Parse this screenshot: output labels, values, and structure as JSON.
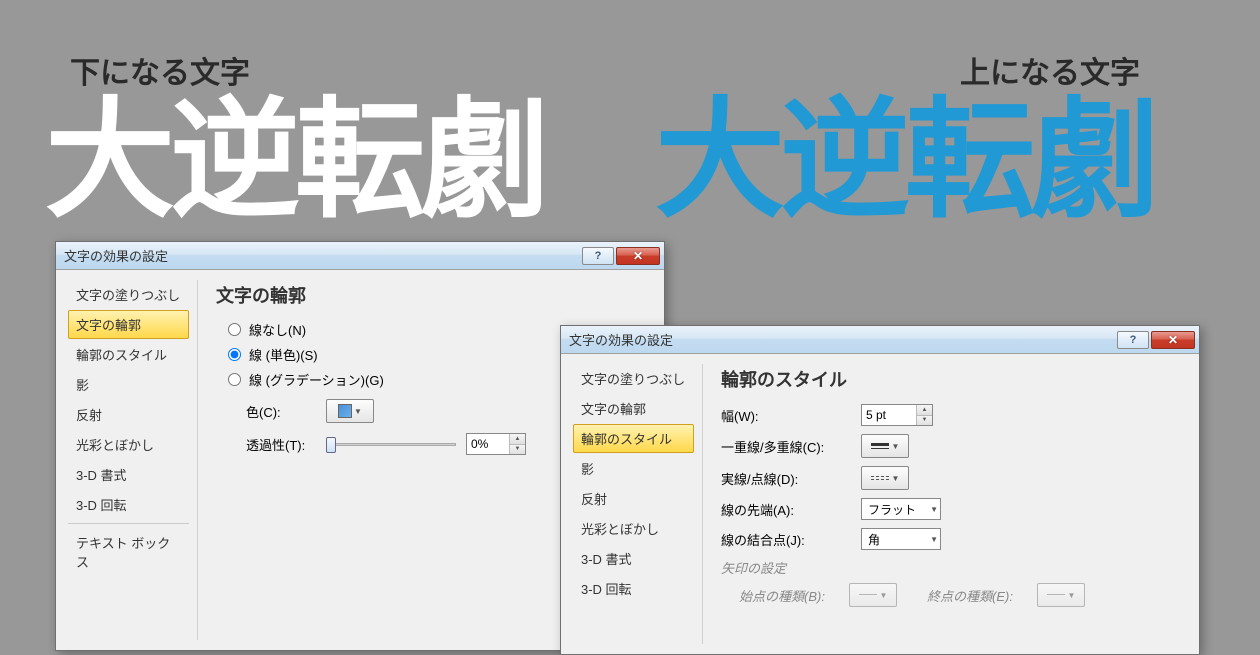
{
  "labels": {
    "bottom_layer": "下になる文字",
    "top_layer": "上になる文字"
  },
  "big_text": {
    "white": "大逆転劇",
    "blue": "大逆転劇"
  },
  "dialog1": {
    "title": "文字の効果の設定",
    "sidebar": [
      "文字の塗りつぶし",
      "文字の輪郭",
      "輪郭のスタイル",
      "影",
      "反射",
      "光彩とぼかし",
      "3-D 書式",
      "3-D 回転",
      "テキスト ボックス"
    ],
    "selected_index": 1,
    "content": {
      "title": "文字の輪郭",
      "radio_none": "線なし(N)",
      "radio_solid": "線 (単色)(S)",
      "radio_gradient": "線 (グラデーション)(G)",
      "color_label": "色(C):",
      "trans_label": "透過性(T):",
      "trans_value": "0%"
    }
  },
  "dialog2": {
    "title": "文字の効果の設定",
    "sidebar": [
      "文字の塗りつぶし",
      "文字の輪郭",
      "輪郭のスタイル",
      "影",
      "反射",
      "光彩とぼかし",
      "3-D 書式",
      "3-D 回転"
    ],
    "selected_index": 2,
    "content": {
      "title": "輪郭のスタイル",
      "width_label": "幅(W):",
      "width_value": "5 pt",
      "compound_label": "一重線/多重線(C):",
      "dash_label": "実線/点線(D):",
      "cap_label": "線の先端(A):",
      "cap_value": "フラット",
      "join_label": "線の結合点(J):",
      "join_value": "角",
      "arrow_group": "矢印の設定",
      "arrow_begin_type": "始点の種類(B):",
      "arrow_end_type": "終点の種類(E):"
    }
  }
}
